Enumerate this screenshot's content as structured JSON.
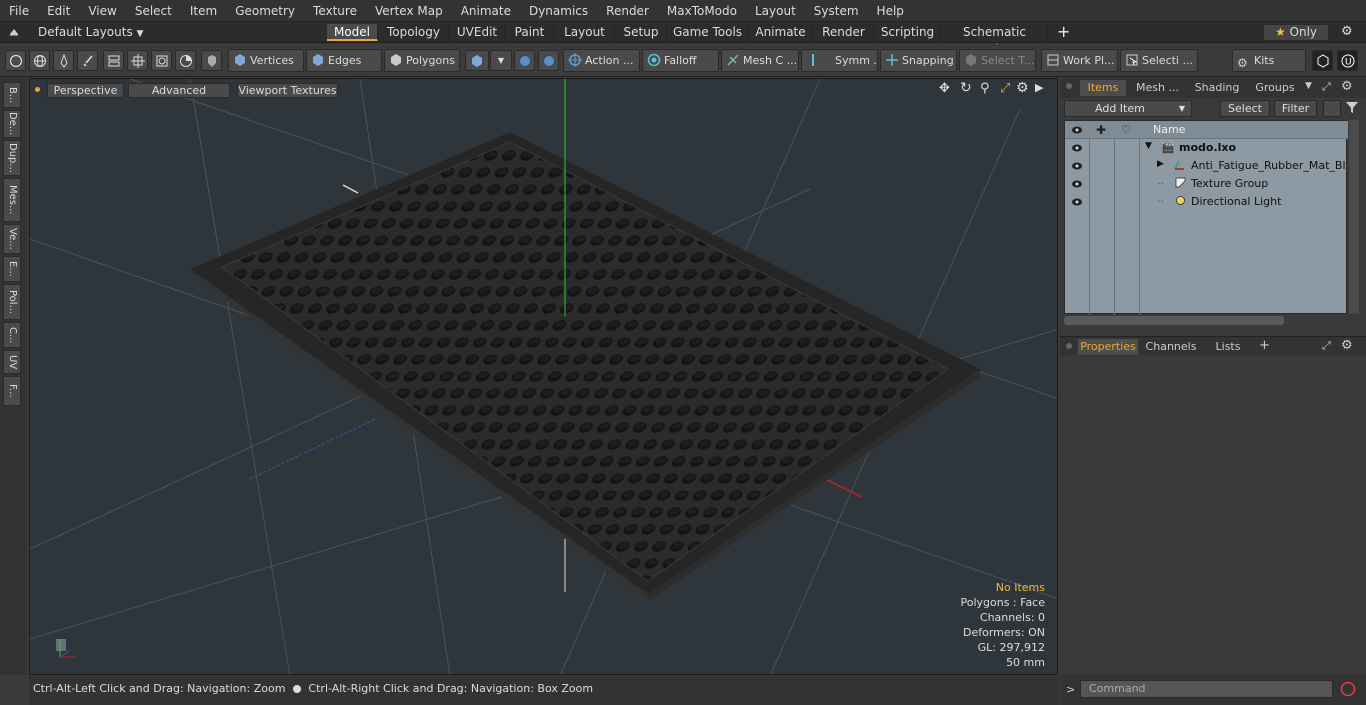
{
  "menu": [
    "File",
    "Edit",
    "View",
    "Select",
    "Item",
    "Geometry",
    "Texture",
    "Vertex Map",
    "Animate",
    "Dynamics",
    "Render",
    "MaxToModo",
    "Layout",
    "System",
    "Help"
  ],
  "layouts": {
    "label": "Default Layouts",
    "tabs": [
      "Model",
      "Topology",
      "UVEdit",
      "Paint",
      "Layout",
      "Setup",
      "Game Tools",
      "Animate",
      "Render",
      "Scripting",
      "Schematic Fusion"
    ],
    "active_tab": "Model",
    "only_label": "Only"
  },
  "toolbar": {
    "vertices": "Vertices",
    "edges": "Edges",
    "polygons": "Polygons",
    "action": "Action ...",
    "falloff": "Falloff",
    "mesh_c": "Mesh C ...",
    "symm": "Symm ...",
    "snapping": "Snapping",
    "select_t": "Select T...",
    "work_pl": "Work Pl...",
    "selecti": "Selecti ...",
    "kits": "Kits"
  },
  "left_tabs": [
    "B...",
    "De...",
    "Dup...",
    "Mes...",
    "Ve...",
    "E...",
    "Pol...",
    "C...",
    "UV",
    "F..."
  ],
  "viewport": {
    "perspective": "Perspective",
    "advanced": "Advanced",
    "viewport_textures": "Viewport Textures",
    "stats": {
      "no_items": "No Items",
      "polygons": "Polygons : Face",
      "channels": "Channels: 0",
      "deformers": "Deformers: ON",
      "gl": "GL: 297,912",
      "scale": "50 mm"
    }
  },
  "status": {
    "left": "Ctrl-Alt-Left Click and Drag: Navigation: Zoom",
    "right": "Ctrl-Alt-Right Click and Drag: Navigation: Box Zoom"
  },
  "items_panel": {
    "tabs": [
      "Items",
      "Mesh ...",
      "Shading",
      "Groups"
    ],
    "active_tab": "Items",
    "add_item": "Add Item",
    "select": "Select",
    "filter": "Filter",
    "name_header": "Name",
    "rows": [
      {
        "label": "modo.lxo"
      },
      {
        "label": "Anti_Fatigue_Rubber_Mat_Bl ..."
      },
      {
        "label": "Texture Group"
      },
      {
        "label": "Directional Light"
      }
    ]
  },
  "properties_panel": {
    "tabs": [
      "Properties",
      "Channels",
      "Lists"
    ],
    "active_tab": "Properties"
  },
  "command": {
    "placeholder": "Command"
  },
  "colors": {
    "accent": "#e8a23a",
    "viewport_bg": "#2f363b",
    "items_bg": "#8d9aa3"
  }
}
